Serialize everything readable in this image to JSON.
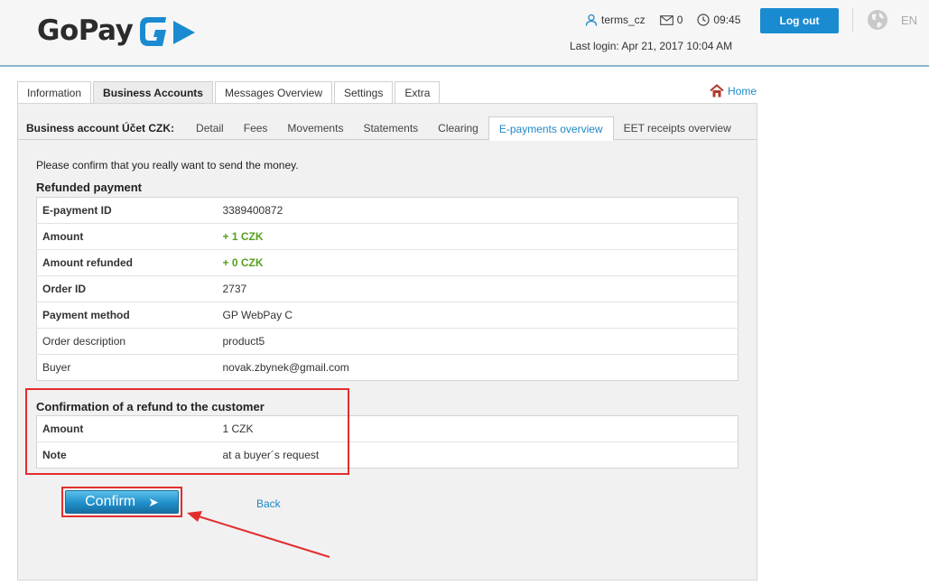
{
  "header": {
    "logo_text": "GoPay",
    "logo_mark": "gopay-g-arrow-logo",
    "user": "terms_cz",
    "messages_count": "0",
    "time": "09:45",
    "last_login": "Last login: Apr 21, 2017 10:04 AM",
    "logout_label": "Log out",
    "language": "EN"
  },
  "main_tabs": [
    {
      "label": "Information"
    },
    {
      "label": "Business Accounts",
      "active": true
    },
    {
      "label": "Messages Overview"
    },
    {
      "label": "Settings"
    },
    {
      "label": "Extra"
    }
  ],
  "home_label": "Home",
  "subnav": {
    "title": "Business account Účet CZK:",
    "tabs": [
      {
        "label": "Detail"
      },
      {
        "label": "Fees"
      },
      {
        "label": "Movements"
      },
      {
        "label": "Statements"
      },
      {
        "label": "Clearing"
      },
      {
        "label": "E-payments overview",
        "active": true
      },
      {
        "label": "EET receipts overview"
      }
    ]
  },
  "intro": "Please confirm that you really want to send the money.",
  "refunded": {
    "title": "Refunded payment",
    "rows": [
      {
        "key": "E-payment ID",
        "value": "3389400872"
      },
      {
        "key": "Amount",
        "value": "+ 1 CZK"
      },
      {
        "key": "Amount refunded",
        "value": "+ 0 CZK"
      },
      {
        "key": "Order ID",
        "value": "2737"
      },
      {
        "key": "Payment method",
        "value": "GP WebPay C"
      },
      {
        "key": "Order description",
        "value": "product5"
      },
      {
        "key": "Buyer",
        "value": "novak.zbynek@gmail.com"
      }
    ]
  },
  "confirmation": {
    "title": "Confirmation of a refund to the customer",
    "rows": [
      {
        "key": "Amount",
        "value": "1 CZK"
      },
      {
        "key": "Note",
        "value": "at a buyer´s request"
      }
    ]
  },
  "confirm_label": "Confirm",
  "back_label": "Back",
  "colors": {
    "accent": "#1b8bd1",
    "positive": "#55a01e",
    "annotation": "#e32d2d"
  }
}
